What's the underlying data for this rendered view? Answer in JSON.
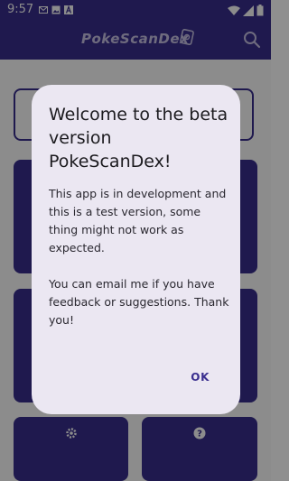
{
  "status_bar": {
    "time": "9:57",
    "icons": [
      "mail-icon",
      "image-icon",
      "a-icon",
      "wifi-icon",
      "signal-icon",
      "battery-icon"
    ]
  },
  "app_bar": {
    "logo": "PokeScanDex",
    "search_icon": "search-icon"
  },
  "background": {
    "settings_icon": "gear-icon",
    "help_icon": "help-icon"
  },
  "dialog": {
    "title": "Welcome to the beta version PokeScanDex!",
    "paragraph1": "This app is in development and this is a test version, some thing might not work as expected.",
    "paragraph2": "You can email me if you have feedback or suggestions. Thank you!",
    "ok_label": "OK"
  },
  "colors": {
    "primary": "#3a2f8f",
    "dialog_bg": "#ebe7f2",
    "scrim": "rgba(0,0,0,0.45)"
  }
}
